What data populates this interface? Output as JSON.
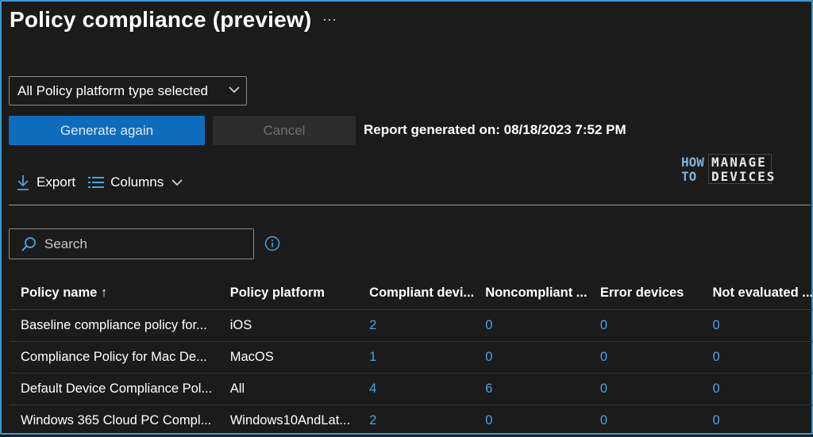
{
  "page": {
    "title": "Policy compliance (preview)",
    "more": "···"
  },
  "filter": {
    "platform_dropdown": "All Policy platform type selected"
  },
  "actions": {
    "generate_label": "Generate again",
    "cancel_label": "Cancel"
  },
  "report": {
    "generated_text": "Report generated on: 08/18/2023 7:52 PM"
  },
  "toolbar": {
    "export_label": "Export",
    "columns_label": "Columns"
  },
  "logo": {
    "line1": "HOW",
    "line2": "TO",
    "line3": "MANAGE",
    "line4": "DEVICES"
  },
  "search": {
    "placeholder": "Search"
  },
  "table": {
    "headers": [
      "Policy name ↑",
      "Policy platform",
      "Compliant devi...",
      "Noncompliant ...",
      "Error devices",
      "Not evaluated ..."
    ],
    "rows": [
      [
        "Baseline compliance policy for...",
        "iOS",
        "2",
        "0",
        "0",
        "0"
      ],
      [
        "Compliance Policy for Mac De...",
        "MacOS",
        "1",
        "0",
        "0",
        "0"
      ],
      [
        "Default Device Compliance Pol...",
        "All",
        "4",
        "6",
        "0",
        "0"
      ],
      [
        "Windows 365 Cloud PC Compl...",
        "Windows10AndLat...",
        "2",
        "0",
        "0",
        "0"
      ]
    ]
  },
  "colors": {
    "accent": "#0f6cbd",
    "link": "#4aa3df",
    "background": "#1b1b1b"
  }
}
